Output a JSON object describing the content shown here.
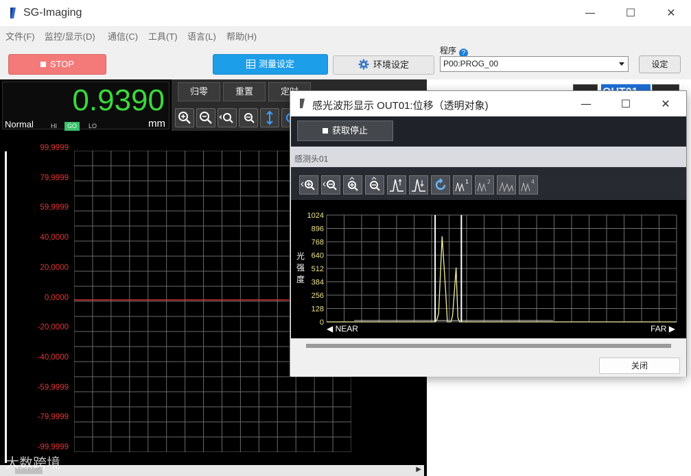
{
  "app": {
    "title": "SG-Imaging",
    "window_controls": [
      "—",
      "☐",
      "✕"
    ]
  },
  "menu": [
    "文件(F)",
    "监控/显示(D)",
    "通信(C)",
    "工具(T)",
    "语言(L)",
    "帮助(H)"
  ],
  "toolbar": {
    "stop_label": "STOP",
    "measure_label": "测量设定",
    "env_label": "环境设定",
    "program_label": "程序",
    "program_value": "P00:PROG_00",
    "set_label": "设定"
  },
  "readout": {
    "value": "0.9390",
    "unit": "mm",
    "status": "Normal",
    "judge": [
      "HI",
      "GO",
      "LO"
    ]
  },
  "main_buttons": [
    "归零",
    "重置",
    "定时"
  ],
  "out_label": "OUT01",
  "main_y_ticks": [
    "99,9999",
    "79,9999",
    "59,9999",
    "40,0000",
    "20,0000",
    "0,0000",
    "-20,0000",
    "-40,0000",
    "-59,9999",
    "-79,9999",
    "-99,9999"
  ],
  "dialog": {
    "title": "感光波形显示 OUT01:位移（透明对象)",
    "acquire_stop": "获取停止",
    "head_label": "感测头01",
    "close_label": "关闭",
    "ylabel": [
      "光",
      "强",
      "度"
    ],
    "near": "NEAR",
    "far": "FAR"
  },
  "chart_data": {
    "type": "line",
    "xlabel": "",
    "ylabel": "光强度",
    "ylim": [
      0,
      1024
    ],
    "yticks": [
      "1024",
      "896",
      "768",
      "640",
      "512",
      "384",
      "256",
      "128",
      "0"
    ],
    "series": [
      {
        "x": [
          0,
          0.28,
          0.31,
          0.315,
          0.32,
          0.33,
          0.34,
          0.345,
          0.355,
          0.36,
          0.37,
          0.375,
          0.38,
          0.39,
          1.0
        ],
        "values": [
          0,
          0,
          0,
          20,
          80,
          820,
          300,
          0,
          0,
          60,
          520,
          40,
          0,
          0,
          0
        ]
      }
    ],
    "markers": [
      0.31,
      0.385
    ]
  },
  "colors": {
    "stop": "#f47a7a",
    "measure": "#1d9ee8",
    "readout": "#3ad93a",
    "axis_red": "#e23535",
    "wave": "#f4f0a0"
  },
  "watermark": "大数跨境"
}
